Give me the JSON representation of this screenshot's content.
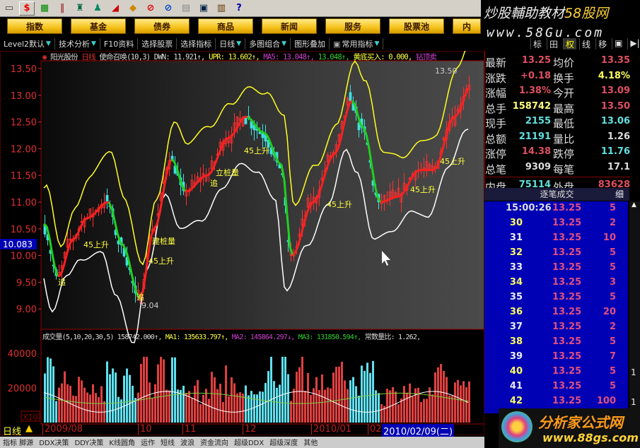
{
  "toolbar": {
    "icons": [
      "ruler-icon",
      "dollar-icon",
      "money-icon",
      "bars-icon",
      "binoculars-icon",
      "bell-icon",
      "alert-icon",
      "diamond-icon",
      "f10-red-icon",
      "f10-blue-icon",
      "page-icon",
      "window-icon",
      "books-icon",
      "help-icon"
    ],
    "dollar": "$",
    "help": "?"
  },
  "brand": {
    "line1": "炒股輔助教材",
    "line1b": "58股网",
    "line2": "www.58Gu.com"
  },
  "nav": [
    "指数",
    "基金",
    "债券",
    "商品",
    "新闻",
    "服务",
    "股票池",
    "内"
  ],
  "menu": [
    "Level2默认",
    "技术分析",
    "F10资料",
    "选择股票",
    "选择指标",
    "日线",
    "多图组合",
    "图形叠加",
    "常用指标"
  ],
  "right_tabs": [
    "标",
    "田",
    "权",
    "线",
    "移",
    "▣",
    "▶|"
  ],
  "chart_header": {
    "name": "阳光股份",
    "period": "日线",
    "indicator": "使命召唤(10,3)",
    "dwn": "DWN: 11.921↑,",
    "upr": "UPR: 13.602↑,",
    "ma5": "MA5: 13.048↑,",
    "ma5b": "13.048↑,",
    "buy": "黄底买入: 0.000,",
    "sell": "钻顶卖"
  },
  "price_axis": [
    "13.50",
    "13.00",
    "12.50",
    "12.00",
    "11.50",
    "11.00",
    "10.50",
    "10.00",
    "9.50",
    "9.00"
  ],
  "current_price_label": "10.083",
  "chart_labels": {
    "high": "13.50",
    "low": "9.04",
    "up45": "45上升",
    "chase": "追",
    "build": "建桩量",
    "stand": "立桩量"
  },
  "volume_header": {
    "title": "成交量(5,10,20,30,5)",
    "value": "158742.000↑,",
    "ma1": "MA1: 135633.797↑,",
    "ma2": "MA2: 145864.297↓,",
    "ma3": "MA3: 131850.594↑,",
    "ratio": "常数量比: 1.262,"
  },
  "volume_axis": [
    "40000",
    "20000"
  ],
  "volume_unit": "X10",
  "date_axis": {
    "period": "日线",
    "ticks": [
      "2009/08",
      "10",
      "11",
      "12",
      "2010/01",
      "02"
    ],
    "selected": "2010/02/09(二)"
  },
  "bottom_tabs": [
    "指标 脚源",
    "DDX决策",
    "DDY决策",
    "K线圆角",
    "运作",
    "短线",
    "波浪",
    "资金流向",
    "超级DDX",
    "超级深度",
    "其他"
  ],
  "quote": {
    "rows": [
      [
        "最新",
        "13.25",
        "均价",
        "13.35"
      ],
      [
        "涨跌",
        "+0.18",
        "换手",
        "4.18%"
      ],
      [
        "涨幅",
        "1.38%",
        "今开",
        "13.09"
      ],
      [
        "总手",
        "158742",
        "最高",
        "13.50"
      ],
      [
        "现手",
        "2155",
        "最低",
        "13.06"
      ],
      [
        "总额",
        "21191",
        "量比",
        "1.26"
      ],
      [
        "涨停",
        "14.38",
        "跌停",
        "11.76"
      ],
      [
        "总笔",
        "9309",
        "每笔",
        "17.1"
      ],
      [
        "内盘",
        "75114",
        "外盘",
        "83628"
      ]
    ],
    "colors": [
      [
        "#e05060",
        "#e05060"
      ],
      [
        "#e05060",
        "#ffff60"
      ],
      [
        "#e05060",
        "#e05060"
      ],
      [
        "#ffff80",
        "#e05060"
      ],
      [
        "#60e0e0",
        "#60e0e0"
      ],
      [
        "#60e0e0",
        "#dddddd"
      ],
      [
        "#e05060",
        "#60e0e0"
      ],
      [
        "#dddddd",
        "#dddddd"
      ],
      [
        "#60e0e0",
        "#e05060"
      ]
    ]
  },
  "trades_title": "逐笔成交",
  "trades_detail": "细",
  "trades": [
    [
      "15:00:26",
      "13.25",
      "5"
    ],
    [
      "30",
      "13.25",
      "2"
    ],
    [
      "31",
      "13.25",
      "10"
    ],
    [
      "32",
      "13.25",
      "5"
    ],
    [
      "33",
      "13.25",
      "5"
    ],
    [
      "34",
      "13.25",
      "3"
    ],
    [
      "35",
      "13.25",
      "5"
    ],
    [
      "36",
      "13.25",
      "20"
    ],
    [
      "37",
      "13.25",
      "2"
    ],
    [
      "38",
      "13.25",
      "5"
    ],
    [
      "39",
      "13.25",
      "7"
    ],
    [
      "40",
      "13.25",
      "5"
    ],
    [
      "41",
      "13.25",
      "5"
    ],
    [
      "42",
      "13.25",
      "100"
    ]
  ],
  "trade_side": [
    "1",
    "1"
  ],
  "logo2": {
    "line1": "分析家公式网",
    "line2": "www.88gs.com"
  }
}
